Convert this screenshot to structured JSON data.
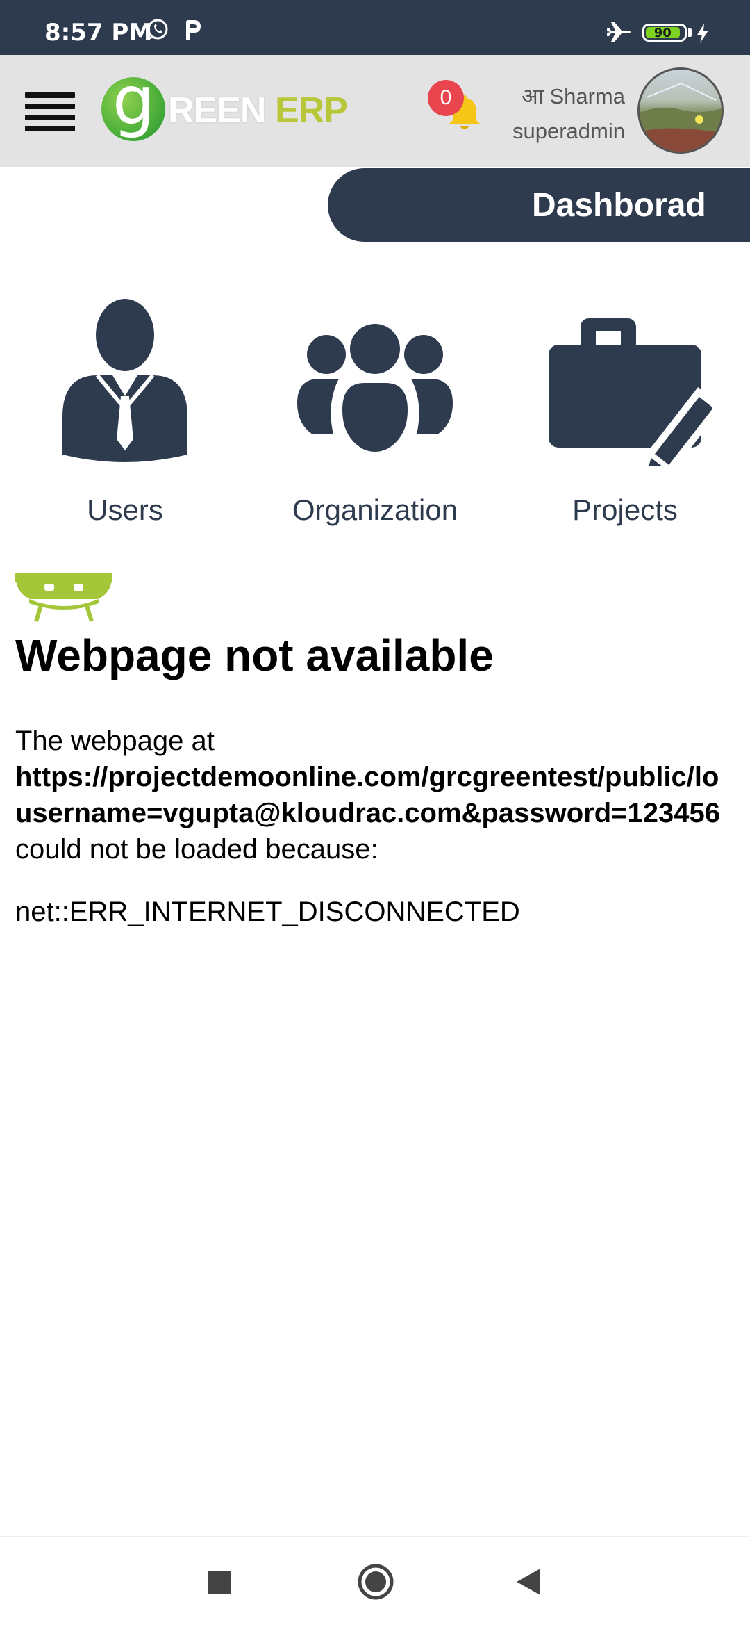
{
  "status_bar": {
    "time": "8:57 PM",
    "battery": "90",
    "icons": [
      "whatsapp-icon",
      "p-app-icon",
      "airplane-icon",
      "battery-icon",
      "charging-icon"
    ]
  },
  "header": {
    "logo_g": "g",
    "logo_reen": "REEN",
    "logo_erp": "ERP",
    "notification_count": "0",
    "user_name": "आ Sharma",
    "user_role": "superadmin"
  },
  "dashboard": {
    "label": "Dashborad"
  },
  "tiles": [
    {
      "label": "Users",
      "icon": "user-icon"
    },
    {
      "label": "Organization",
      "icon": "organization-icon"
    },
    {
      "label": "Projects",
      "icon": "projects-icon"
    }
  ],
  "error": {
    "title": "Webpage not available",
    "intro": "The webpage at",
    "url_line1": "https://projectdemoonline.com/grcgreentest/public/lo",
    "url_line2": "username=vgupta@kloudrac.com&password=123456",
    "reason": "could not be loaded because:",
    "code": "net::ERR_INTERNET_DISCONNECTED"
  },
  "colors": {
    "primary": "#2e3a4d",
    "header_bg": "#e3e3e3",
    "badge": "#e8454f",
    "bell": "#f5c518",
    "logo_green": "#3aa535",
    "logo_erp": "#b8c73a",
    "android": "#a4c639"
  },
  "nav": {
    "buttons": [
      "recents-button",
      "home-button",
      "back-button"
    ]
  }
}
